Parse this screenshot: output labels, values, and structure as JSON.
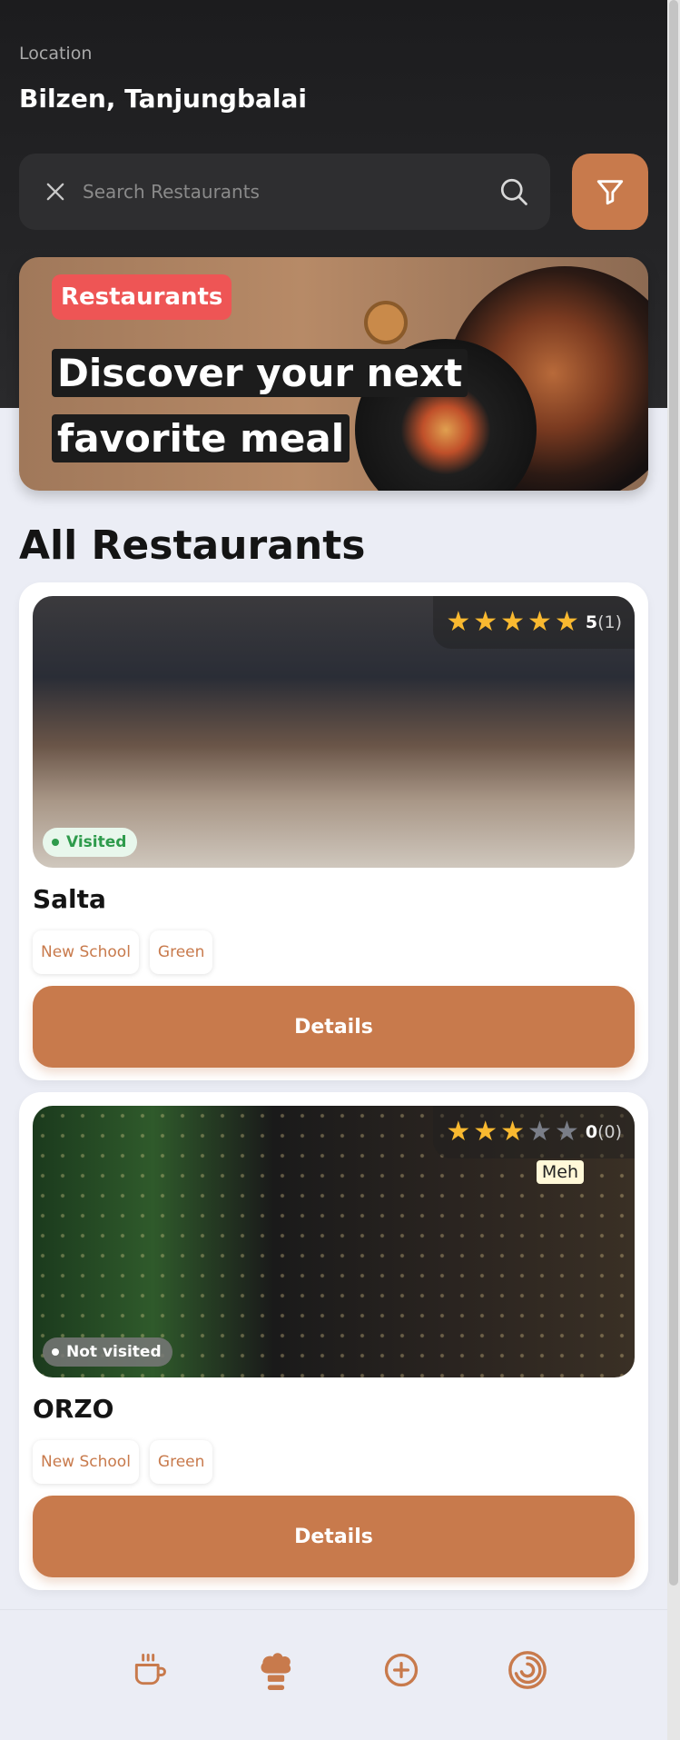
{
  "header": {
    "location_label": "Location",
    "location_value": "Bilzen, Tanjungbalai"
  },
  "search": {
    "placeholder": "Search Restaurants",
    "value": ""
  },
  "banner": {
    "tag": "Restaurants",
    "headline_line1": "Discover your next",
    "headline_line2": "favorite meal"
  },
  "section_title": "All Restaurants",
  "restaurants": [
    {
      "name": "Salta",
      "rating_value": "5",
      "rating_count": "(1)",
      "stars_filled": 5,
      "visit_status": "Visited",
      "tags": [
        "New School",
        "Green"
      ],
      "details_label": "Details"
    },
    {
      "name": "ORZO",
      "rating_value": "0",
      "rating_count": "(0)",
      "stars_filled": 3,
      "rating_tooltip": "Meh",
      "visit_status": "Not visited",
      "tags": [
        "New School",
        "Green"
      ],
      "details_label": "Details"
    }
  ],
  "bottom_nav": {
    "items": [
      "coffee-cup-icon",
      "chef-hat-icon",
      "add-circle-icon",
      "spiral-icon"
    ],
    "active_index": 1
  },
  "colors": {
    "accent": "#c87a4c",
    "header_bg": "#1c1c1e",
    "banner_tag": "#ee5555",
    "star": "#f9b930",
    "visited": "#2e9b4c"
  }
}
